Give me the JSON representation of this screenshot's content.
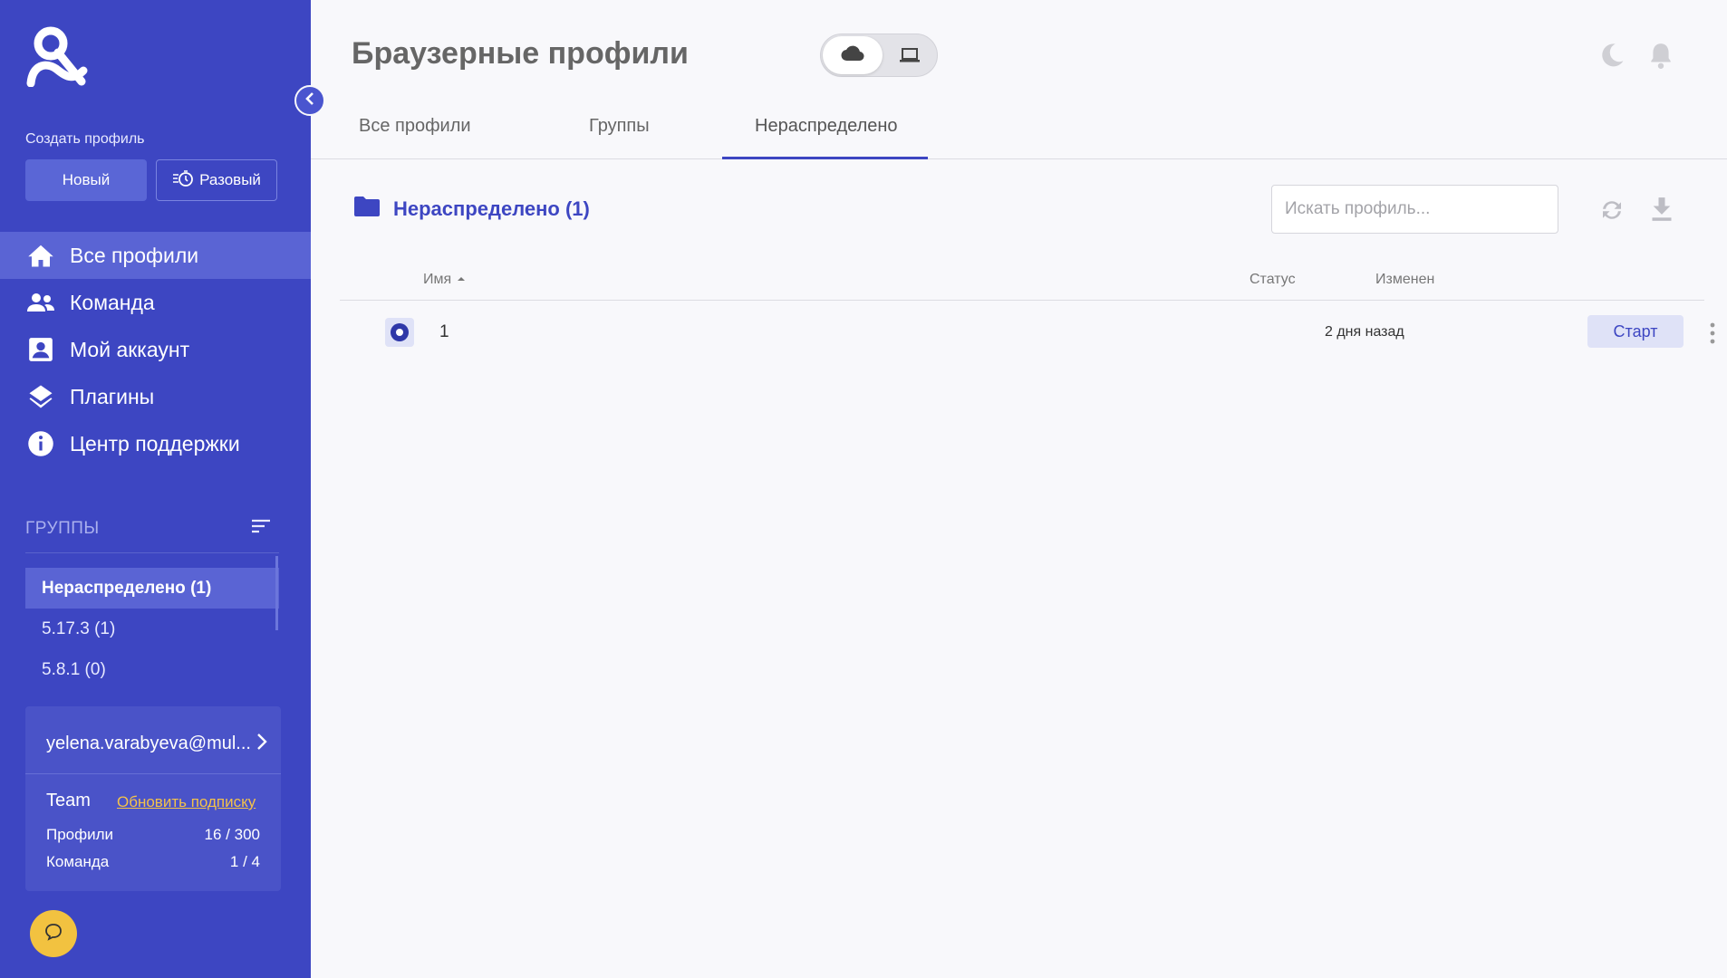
{
  "sidebar": {
    "create_label": "Создать профиль",
    "new_button": "Новый",
    "once_button": "Разовый",
    "nav": [
      {
        "label": "Все профили",
        "icon": "home-icon",
        "active": true
      },
      {
        "label": "Команда",
        "icon": "team-icon",
        "active": false
      },
      {
        "label": "Мой аккаунт",
        "icon": "account-icon",
        "active": false
      },
      {
        "label": "Плагины",
        "icon": "layers-icon",
        "active": false
      },
      {
        "label": "Центр поддержки",
        "icon": "info-icon",
        "active": false
      }
    ],
    "groups_title": "ГРУППЫ",
    "groups": [
      {
        "name": "Нераспределено",
        "count": "(1)",
        "active": true
      },
      {
        "name": "5.17.3",
        "count": "(1)",
        "active": false
      },
      {
        "name": "5.8.1",
        "count": "(0)",
        "active": false
      }
    ],
    "account": {
      "email": "yelena.varabyeva@mul...",
      "plan": "Team",
      "upgrade_link": "Обновить подписку",
      "profiles_label": "Профили",
      "profiles_value": "16 / 300",
      "team_label": "Команда",
      "team_value": "1 / 4"
    }
  },
  "header": {
    "title": "Браузерные профили"
  },
  "tabs": [
    "Все профили",
    "Группы",
    "Нераспределено"
  ],
  "active_tab": "Нераспределено",
  "folder": {
    "title": "Нераспределено (1)"
  },
  "search": {
    "placeholder": "Искать профиль..."
  },
  "table": {
    "columns": {
      "name": "Имя",
      "status": "Статус",
      "modified": "Изменен"
    },
    "rows": [
      {
        "name": "1",
        "status": "",
        "modified": "2 дня назад",
        "action": "Старт"
      }
    ]
  },
  "colors": {
    "sidebar": "#3d46c2",
    "accent": "#3d46c2",
    "chat_button": "#f2c240",
    "upgrade_link": "#f3c24a"
  }
}
